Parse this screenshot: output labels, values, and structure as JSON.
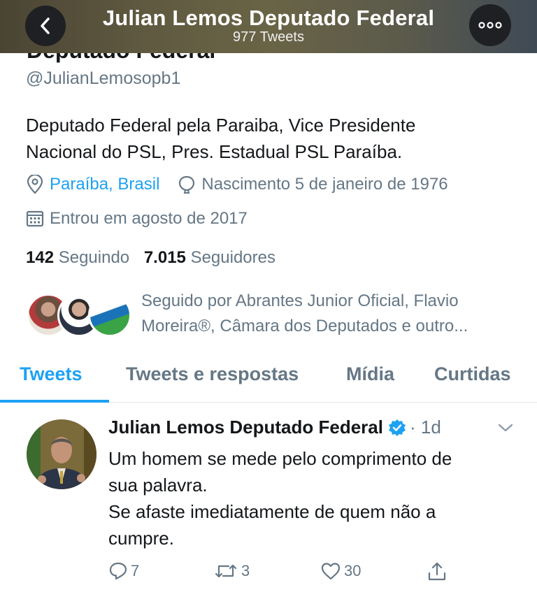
{
  "header": {
    "title": "Julian Lemos Deputado Federal",
    "subtitle": "977 Tweets"
  },
  "profile": {
    "partial_name": "Deputado Federal",
    "handle": "@JulianLemosopb1",
    "bio_line1": "Deputado Federal pela Paraiba, Vice Presidente",
    "bio_line2": "Nacional do PSL, Pres. Estadual PSL Paraíba.",
    "location": "Paraíba, Brasil",
    "birth": "Nascimento 5 de janeiro de 1976",
    "joined": "Entrou em agosto de 2017",
    "following_count": "142",
    "following_label": "Seguindo",
    "followers_count": "7.015",
    "followers_label": "Seguidores",
    "followed_by_line1": "Seguido por Abrantes Junior Oficial, Flavio",
    "followed_by_line2": "Moreira®, Câmara dos Deputados e outro..."
  },
  "tabs": [
    {
      "label": "Tweets",
      "active": true
    },
    {
      "label": "Tweets e respostas",
      "active": false
    },
    {
      "label": "Mídia",
      "active": false
    },
    {
      "label": "Curtidas",
      "active": false
    }
  ],
  "tweet": {
    "author": "Julian Lemos Deputado Federal",
    "time": "· 1d",
    "line1": "Um homem se mede pelo comprimento de",
    "line2": "sua palavra.",
    "line3": "Se afaste imediatamente de quem não a",
    "line4": "cumpre.",
    "replies": "7",
    "retweets": "3",
    "likes": "30"
  },
  "colors": {
    "accent": "#1da1f2",
    "secondary_text": "#657786",
    "primary_text": "#14171a"
  },
  "icons": [
    "back-icon",
    "more-icon",
    "location-icon",
    "birthday-icon",
    "calendar-icon",
    "verified-icon",
    "chevron-down-icon",
    "reply-icon",
    "retweet-icon",
    "like-icon",
    "share-icon"
  ]
}
